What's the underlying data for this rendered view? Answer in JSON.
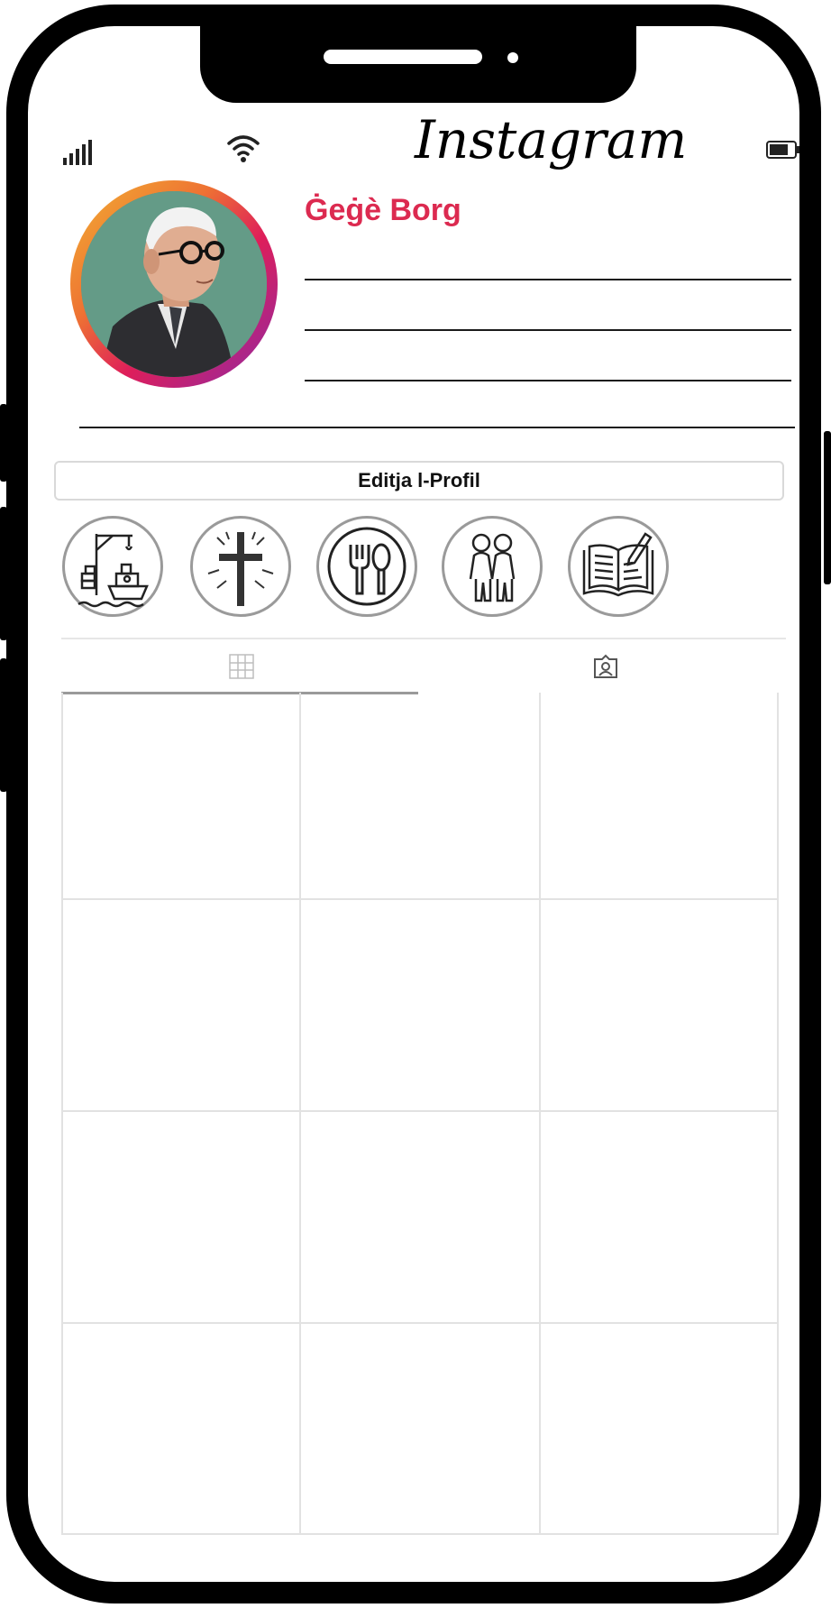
{
  "status_bar": {
    "signal_icon": "signal-bars-icon",
    "wifi_icon": "wifi-icon",
    "battery_icon": "battery-icon"
  },
  "app": {
    "title": "Instagram"
  },
  "profile": {
    "name": "Ġeġè Borg",
    "name_color": "#dc2a50",
    "avatar": "portrait-photo",
    "edit_button_label": "Editja l-Profil"
  },
  "highlights": [
    {
      "icon": "harbour-ship-crane-icon"
    },
    {
      "icon": "cross-icon"
    },
    {
      "icon": "fork-spoon-plate-icon"
    },
    {
      "icon": "couple-icon"
    },
    {
      "icon": "open-book-pen-icon"
    }
  ],
  "tabs": [
    {
      "icon": "grid-icon",
      "active": true
    },
    {
      "icon": "tagged-person-icon",
      "active": false
    }
  ],
  "colors": {
    "ring_gradient": [
      "#f2b233",
      "#ee7233",
      "#de1e5a",
      "#8c2aa6"
    ],
    "frame": "#000000"
  }
}
